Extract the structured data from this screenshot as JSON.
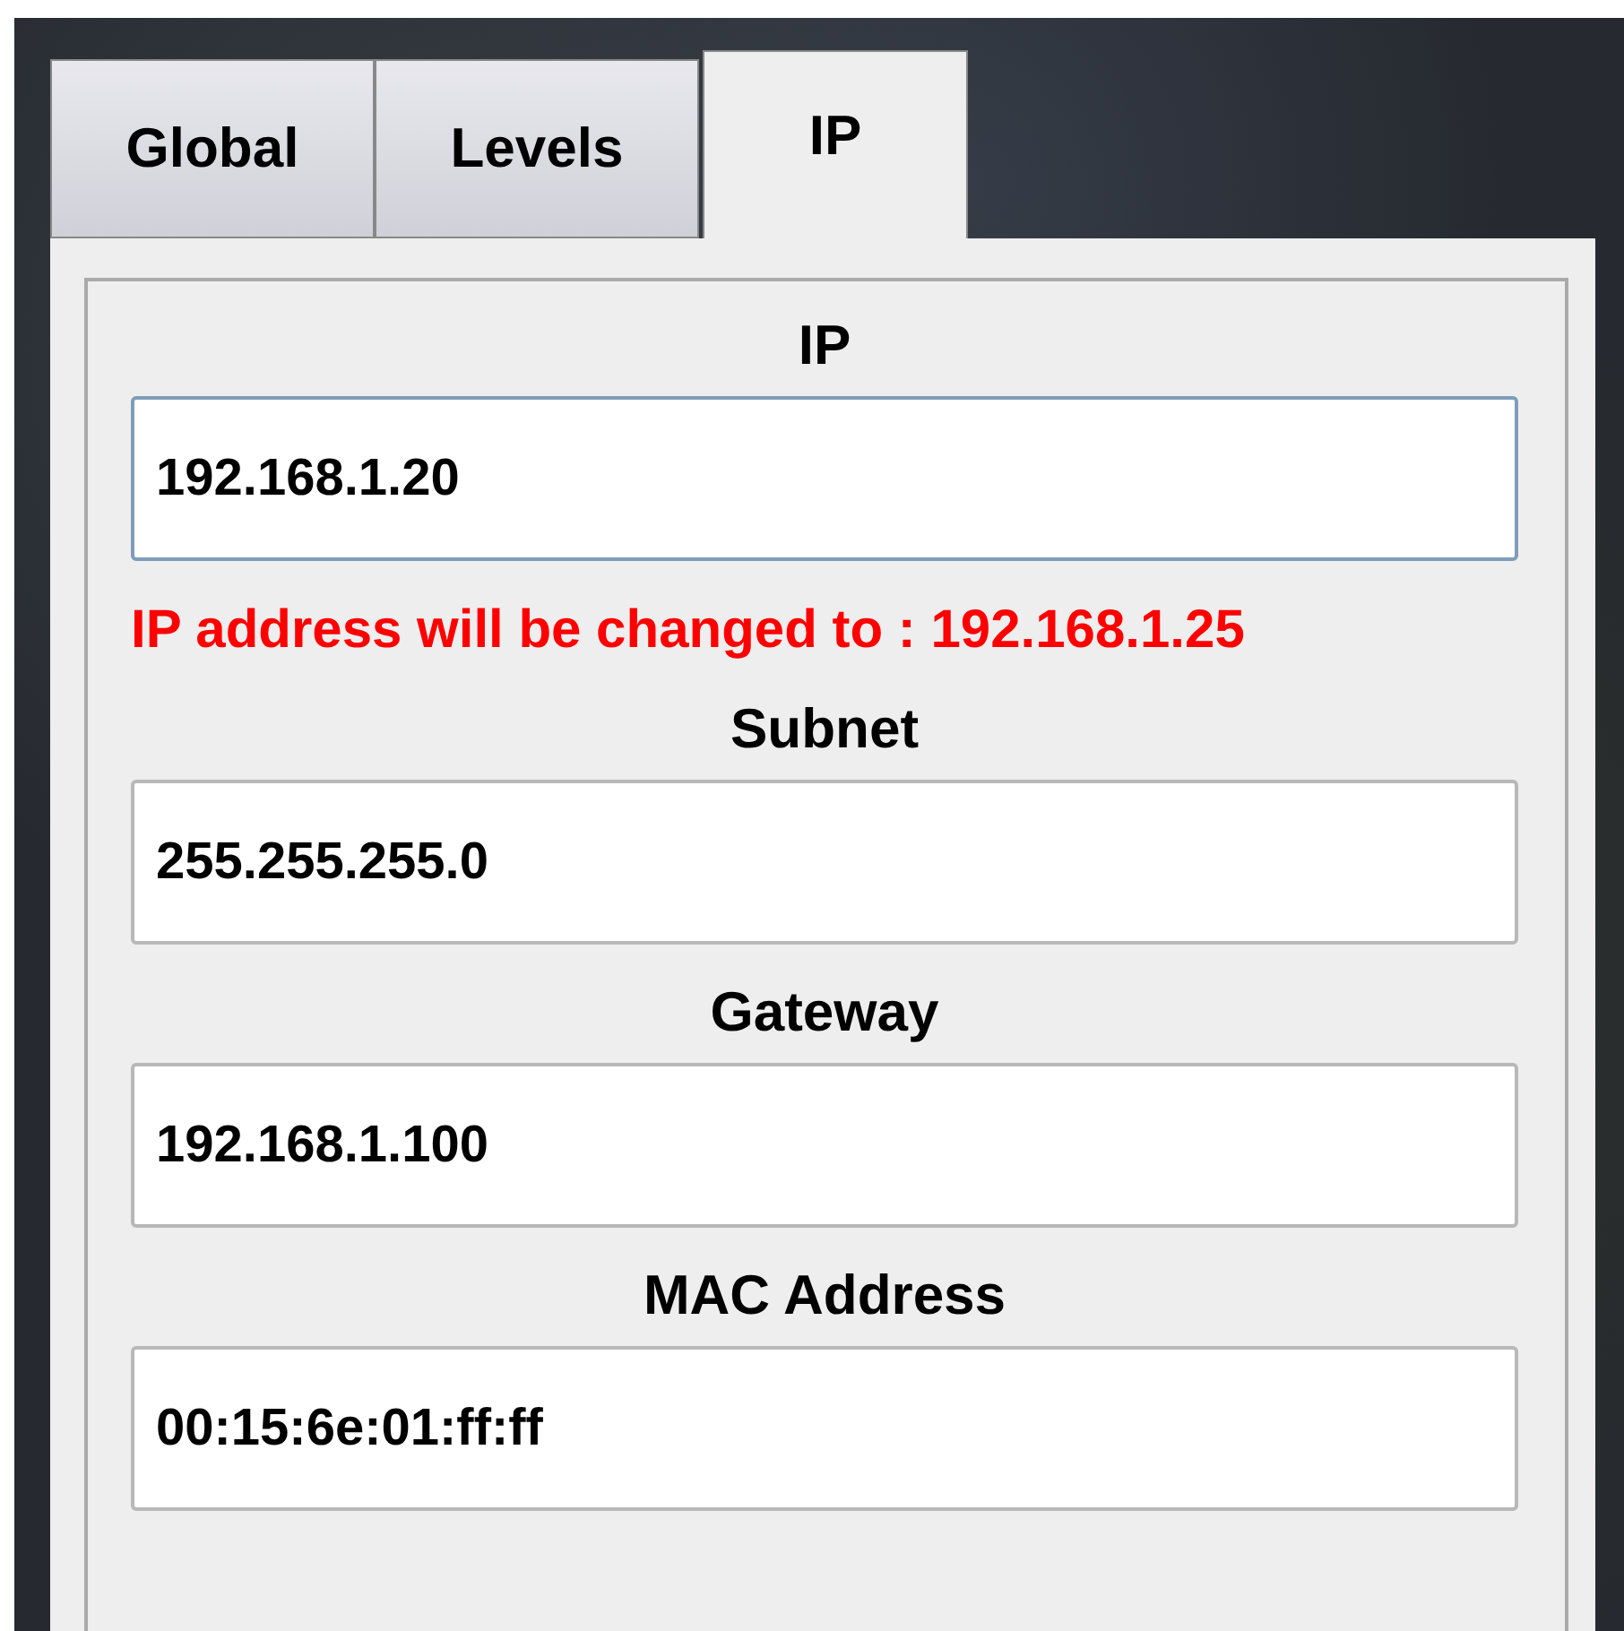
{
  "tabs": [
    {
      "label": "Global",
      "selected": false
    },
    {
      "label": "Levels",
      "selected": false
    },
    {
      "label": "IP",
      "selected": true
    }
  ],
  "fields": [
    {
      "label": "IP",
      "value": "192.168.1.20",
      "focused": true,
      "note": "IP address will be changed to : 192.168.1.25"
    },
    {
      "label": "Subnet",
      "value": "255.255.255.0",
      "focused": false
    },
    {
      "label": "Gateway",
      "value": "192.168.1.100",
      "focused": false
    },
    {
      "label": "MAC Address",
      "value": "00:15:6e:01:ff:ff",
      "focused": false
    }
  ]
}
